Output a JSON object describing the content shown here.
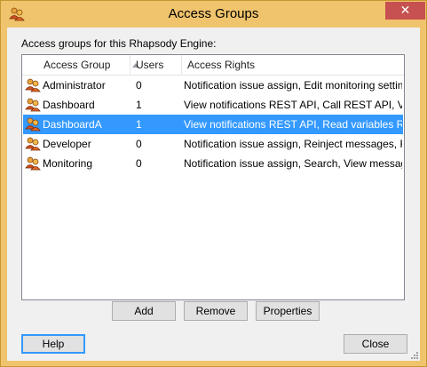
{
  "window": {
    "title": "Access Groups",
    "close_glyph": "✕",
    "icon": "users-group-icon"
  },
  "caption": "Access groups for this Rhapsody Engine:",
  "columns": [
    {
      "label": "Access Group",
      "sorted": "ascending"
    },
    {
      "label": "Users"
    },
    {
      "label": "Access Rights"
    }
  ],
  "rows": [
    {
      "group": "Administrator",
      "users": "0",
      "rights": "Notification issue assign, Edit monitoring settings, ...",
      "selected": false
    },
    {
      "group": "Dashboard",
      "users": "1",
      "rights": "View notifications REST API, Call REST API, Vie...",
      "selected": false
    },
    {
      "group": "DashboardA",
      "users": "1",
      "rights": "View notifications REST API, Read variables RES...",
      "selected": true
    },
    {
      "group": "Developer",
      "users": "0",
      "rights": "Notification issue assign, Reinject messages, Redi...",
      "selected": false
    },
    {
      "group": "Monitoring",
      "users": "0",
      "rights": "Notification issue assign, Search, View message b...",
      "selected": false
    }
  ],
  "buttons": {
    "add": "Add",
    "remove": "Remove",
    "properties": "Properties",
    "help": "Help",
    "close": "Close"
  },
  "colors": {
    "frame": "#f0c46d",
    "selection": "#3399ff",
    "close_button": "#c75050"
  }
}
